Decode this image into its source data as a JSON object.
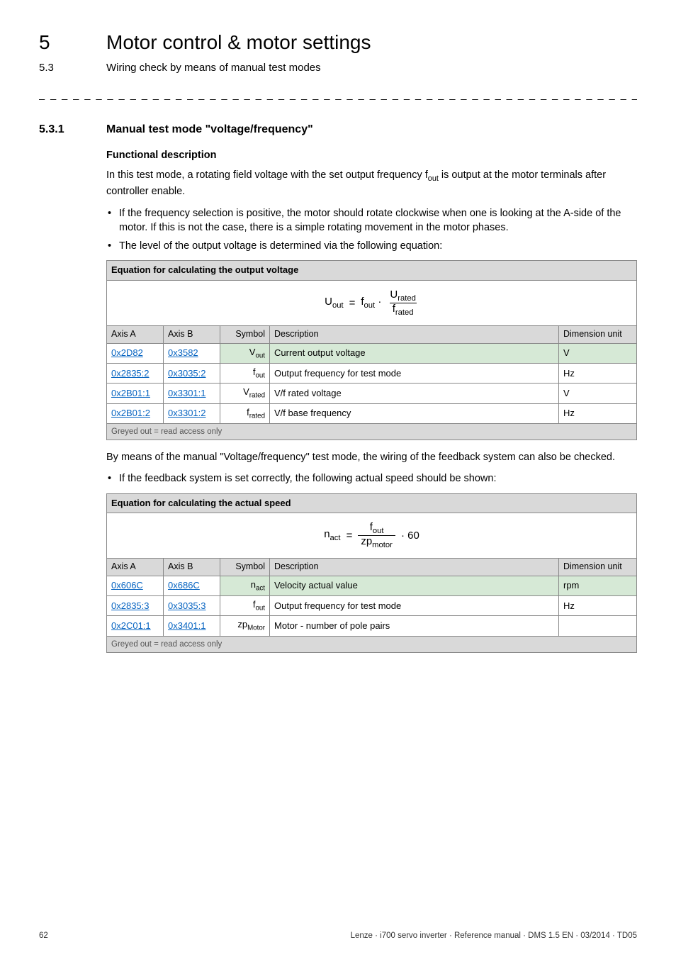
{
  "header": {
    "chapter_num": "5",
    "chapter_title": "Motor control & motor settings",
    "section_num": "5.3",
    "section_title": "Wiring check by means of manual test modes"
  },
  "subsection": {
    "num": "5.3.1",
    "title": "Manual test mode \"voltage/frequency\""
  },
  "fd_label": "Functional description",
  "intro1_a": "In this test mode, a rotating field voltage with the set output frequency f",
  "intro1_sub": "out",
  "intro1_b": " is output at the motor terminals after controller enable.",
  "bullets1": [
    "If the frequency selection is positive, the motor should rotate clockwise when one is looking at the A-side of the motor. If this is not the case, there is a simple rotating movement in the motor phases.",
    "The level of the output voltage is determined via the following equation:"
  ],
  "table1": {
    "title": "Equation for calculating the output voltage",
    "headers": {
      "axisA": "Axis A",
      "axisB": "Axis B",
      "symbol": "Symbol",
      "desc": "Description",
      "dim": "Dimension unit"
    },
    "rows": [
      {
        "a": "0x2D82",
        "b": "0x3582",
        "sym_html": "V<sub>out</sub>",
        "desc": "Current output voltage",
        "unit": "V",
        "green": true
      },
      {
        "a": "0x2835:2",
        "b": "0x3035:2",
        "sym_html": "f<sub>out</sub>",
        "desc": "Output frequency for test mode",
        "unit": "Hz",
        "green": false
      },
      {
        "a": "0x2B01:1",
        "b": "0x3301:1",
        "sym_html": "V<sub>rated</sub>",
        "desc": "V/f rated voltage",
        "unit": "V",
        "green": false
      },
      {
        "a": "0x2B01:2",
        "b": "0x3301:2",
        "sym_html": "f<sub>rated</sub>",
        "desc": "V/f base frequency",
        "unit": "Hz",
        "green": false
      }
    ],
    "footnote": "Greyed out = read access only"
  },
  "mid_para": "By means of the manual \"Voltage/frequency\" test mode, the wiring of the feedback system can also be checked.",
  "bullets2": [
    "If the feedback system is set correctly, the following actual speed should be shown:"
  ],
  "table2": {
    "title": "Equation for calculating the actual speed",
    "headers": {
      "axisA": "Axis A",
      "axisB": "Axis B",
      "symbol": "Symbol",
      "desc": "Description",
      "dim": "Dimension unit"
    },
    "rows": [
      {
        "a": "0x606C",
        "b": "0x686C",
        "sym_html": "n<sub>act</sub>",
        "desc": "Velocity actual value",
        "unit": "rpm",
        "green": true
      },
      {
        "a": "0x2835:3",
        "b": "0x3035:3",
        "sym_html": "f<sub>out</sub>",
        "desc": "Output frequency for test mode",
        "unit": "Hz",
        "green": false
      },
      {
        "a": "0x2C01:1",
        "b": "0x3401:1",
        "sym_html": "zp<sub>Motor</sub>",
        "desc": "Motor - number of pole pairs",
        "unit": "",
        "green": false
      }
    ],
    "footnote": "Greyed out = read access only"
  },
  "eq1": {
    "lhs": "U<sub>out</sub>",
    "op1": "=",
    "mid": "f<sub>out</sub> ·",
    "num": "U<sub>rated</sub>",
    "den": "f<sub>rated</sub>"
  },
  "eq2": {
    "lhs": "n<sub>act</sub>",
    "op1": "=",
    "num": "f<sub>out</sub>",
    "den": "zp<sub>motor</sub>",
    "tail": "· 60"
  },
  "footer": {
    "page": "62",
    "info": "Lenze · i700 servo inverter · Reference manual · DMS 1.5 EN · 03/2014 · TD05"
  },
  "chart_data": null
}
